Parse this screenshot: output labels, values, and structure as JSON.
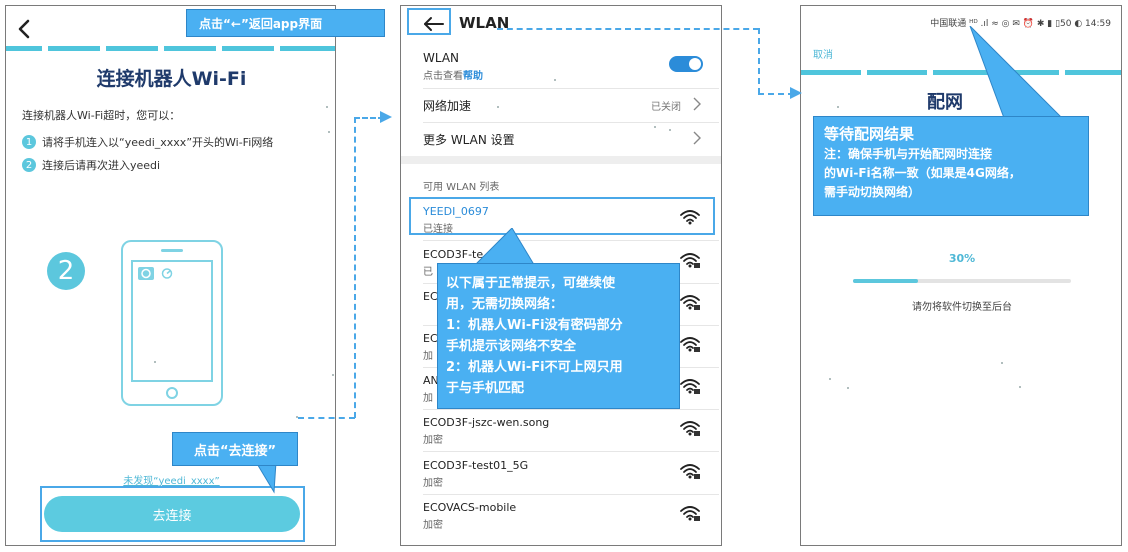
{
  "panel1": {
    "title": "连接机器人Wi-Fi",
    "intro": "连接机器人Wi-Fi超时，您可以：",
    "steps": [
      {
        "num": "1",
        "text": "请将手机连入以“yeedi_xxxx”开头的Wi-Fi网络"
      },
      {
        "num": "2",
        "text": "连接后请再次进入yeedi"
      }
    ],
    "big_step": "2",
    "not_found_link": "未发现“yeedi_xxxx”",
    "connect_button": "去连接"
  },
  "callouts": {
    "back_to_app": "点击“←”返回app界面",
    "go_connect": "点击“去连接”",
    "normal_tip": [
      "以下属于正常提示，可继续使",
      "用，无需切换网络：",
      "1：机器人Wi-Fi没有密码部分",
      "手机提示该网络不安全",
      "2：机器人Wi-Fi不可上网只用",
      "于与手机匹配"
    ],
    "wait_result": {
      "title": "等待配网结果",
      "lines": [
        "注：确保手机与开始配网时连接",
        "的Wi-Fi名称一致（如果是4G网络，",
        "需手动切换网络）"
      ]
    }
  },
  "panel2": {
    "header_title": "WLAN",
    "wlan_label": "WLAN",
    "wlan_sub_prefix": "点击查看",
    "wlan_sub_link": "帮助",
    "wlan_enabled": true,
    "network_boost_label": "网络加速",
    "network_boost_value": "已关闭",
    "more_settings_label": "更多 WLAN 设置",
    "list_title": "可用 WLAN 列表",
    "networks": [
      {
        "name": "YEEDI_0697",
        "status": "已连接"
      },
      {
        "name": "ECOD3F-te",
        "status": "已"
      },
      {
        "name": "EC",
        "status": ""
      },
      {
        "name": "EC",
        "status": "加"
      },
      {
        "name": "AN",
        "status": "加"
      },
      {
        "name": "ECOD3F-jszc-wen.song",
        "status": "加密"
      },
      {
        "name": "ECOD3F-test01_5G",
        "status": "加密"
      },
      {
        "name": "ECOVACS-mobile",
        "status": "加密"
      }
    ]
  },
  "panel3": {
    "status_bar": "中国联通 ᴴᴰ .ıl ≈ ◎   ✉ ⏰ ✱ ▮ ▯50 ◐ 14:59",
    "cancel": "取消",
    "title_partial": "配网",
    "progress_text": "30%",
    "progress_value": 0.3,
    "hint": "请勿将软件切换至后台"
  },
  "colors": {
    "accent": "#5cc7dd",
    "callout": "#4ab0f2",
    "title": "#1f3a6b",
    "toggle": "#2b8cd9"
  }
}
